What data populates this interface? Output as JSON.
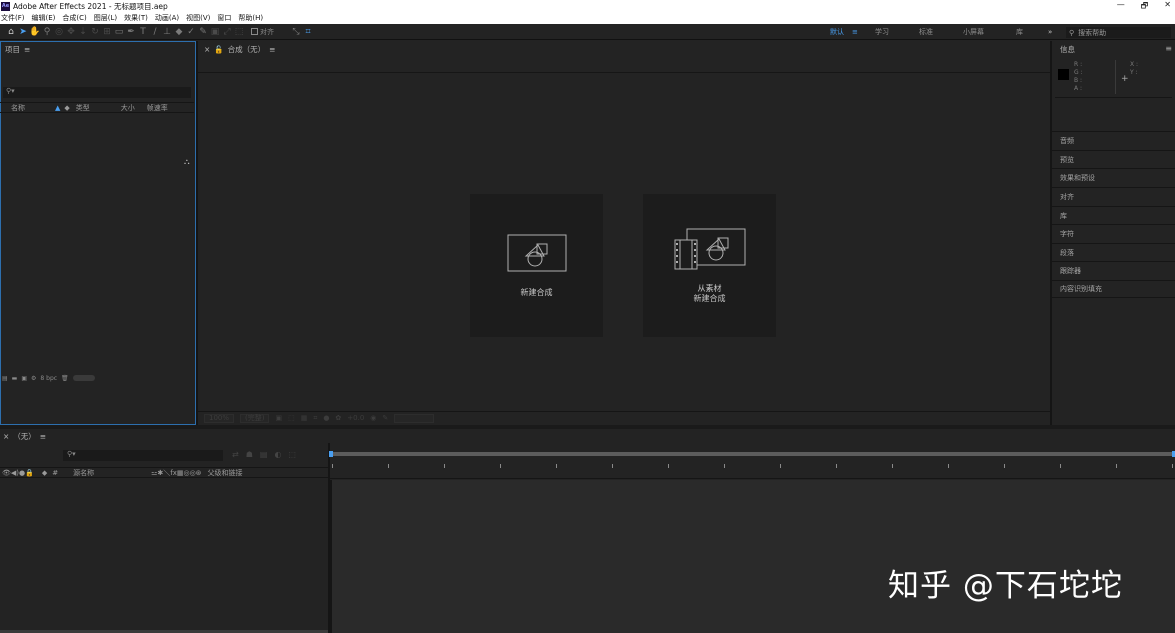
{
  "window": {
    "title": "Adobe After Effects 2021 - 无标题项目.aep",
    "app_icon": "Ae",
    "controls": [
      "—",
      "🗗",
      "✕"
    ]
  },
  "menu": [
    "文件(F)",
    "编辑(E)",
    "合成(C)",
    "图层(L)",
    "效果(T)",
    "动画(A)",
    "视图(V)",
    "窗口",
    "帮助(H)"
  ],
  "toolbar": {
    "snap_label": "对齐"
  },
  "workspaces": {
    "default": "默认",
    "learn": "学习",
    "standard": "标准",
    "small_screen": "小屏幕",
    "library": "库",
    "more": "»",
    "search_placeholder": "搜索帮助"
  },
  "project_panel": {
    "title": "项目",
    "menu": "≡",
    "columns": {
      "name": "名称",
      "type": "类型",
      "size": "大小",
      "frame_rate": "帧速率"
    },
    "bpc": "8 bpc"
  },
  "comp_panel": {
    "close": "×",
    "tab": "合成（无）",
    "menu": "≡",
    "new_comp_label": "新建合成",
    "from_footage_line1": "从素材",
    "from_footage_line2": "新建合成",
    "footer": {
      "zoom": "100%",
      "resolution": "(完整)",
      "exposure": "+0.0"
    }
  },
  "info_panel": {
    "title": "信息",
    "menu": "≡",
    "r": "R :",
    "g": "G :",
    "b": "B :",
    "a": "A :",
    "x": "X :",
    "y": "Y :"
  },
  "right_panels": [
    "音频",
    "预览",
    "效果和预设",
    "对齐",
    "库",
    "字符",
    "段落",
    "跟踪器",
    "内容识别填充"
  ],
  "timeline": {
    "close": "×",
    "tab": "（无）",
    "menu": "≡",
    "columns": {
      "source_name": "源名称",
      "parent": "父级和链接"
    }
  },
  "watermark": "知乎 @下石坨坨"
}
